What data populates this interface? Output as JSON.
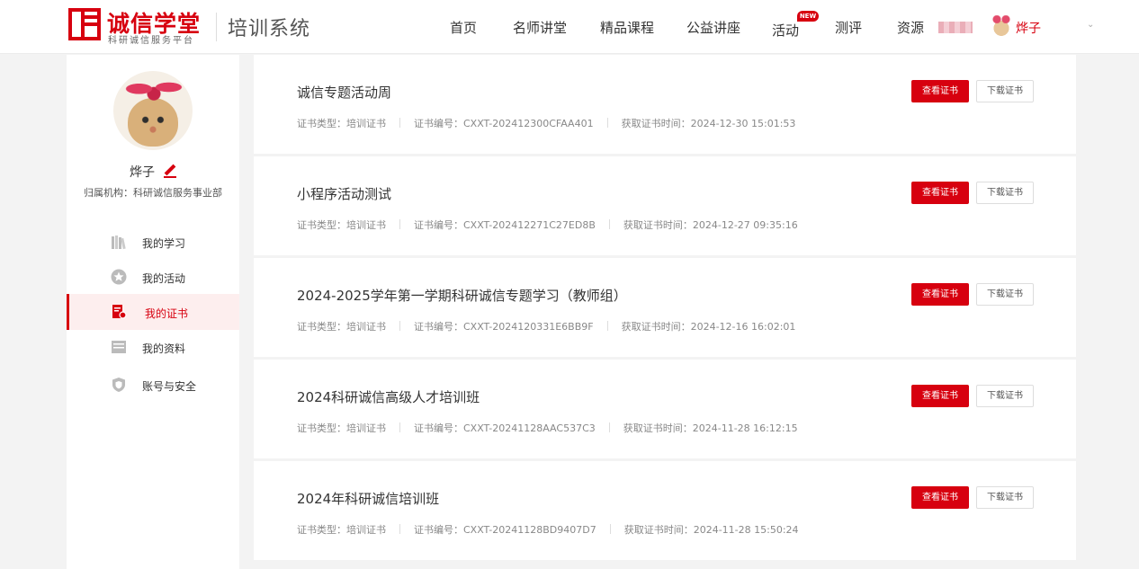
{
  "header": {
    "logo_name": "诚信学堂",
    "logo_sub": "科研诚信服务平台",
    "system_title": "培训系统",
    "nav": [
      {
        "label": "首页"
      },
      {
        "label": "名师讲堂"
      },
      {
        "label": "精品课程"
      },
      {
        "label": "公益讲座"
      },
      {
        "label": "活动",
        "badge": "NEW"
      },
      {
        "label": "测评"
      },
      {
        "label": "资源"
      }
    ],
    "username": "烨子",
    "accent_color": "#d7000f"
  },
  "profile": {
    "name": "烨子",
    "org": "归属机构：科研诚信服务事业部"
  },
  "menu": [
    {
      "label": "我的学习",
      "icon": "books-icon",
      "active": false
    },
    {
      "label": "我的活动",
      "icon": "star-icon",
      "active": false
    },
    {
      "label": "我的证书",
      "icon": "certificate-icon",
      "active": true
    },
    {
      "label": "我的资料",
      "icon": "profile-card-icon",
      "active": false
    },
    {
      "label": "账号与安全",
      "icon": "shield-icon",
      "active": false
    }
  ],
  "certificates": [
    {
      "title": "诚信专题活动周",
      "type": "证书类型：培训证书",
      "code": "证书编号：CXXT-202412300CFAA401",
      "time": "获取证书时间：2024-12-30 15:01:53"
    },
    {
      "title": "小程序活动测试",
      "type": "证书类型：培训证书",
      "code": "证书编号：CXXT-202412271C27ED8B",
      "time": "获取证书时间：2024-12-27 09:35:16"
    },
    {
      "title": "2024-2025学年第一学期科研诚信专题学习（教师组）",
      "type": "证书类型：培训证书",
      "code": "证书编号：CXXT-2024120331E6BB9F",
      "time": "获取证书时间：2024-12-16 16:02:01"
    },
    {
      "title": "2024科研诚信高级人才培训班",
      "type": "证书类型：培训证书",
      "code": "证书编号：CXXT-20241128AAC537C3",
      "time": "获取证书时间：2024-11-28 16:12:15"
    },
    {
      "title": "2024年科研诚信培训班",
      "type": "证书类型：培训证书",
      "code": "证书编号：CXXT-20241128BD9407D7",
      "time": "获取证书时间：2024-11-28 15:50:24"
    }
  ],
  "buttons": {
    "view": "查看证书",
    "download": "下载证书"
  }
}
